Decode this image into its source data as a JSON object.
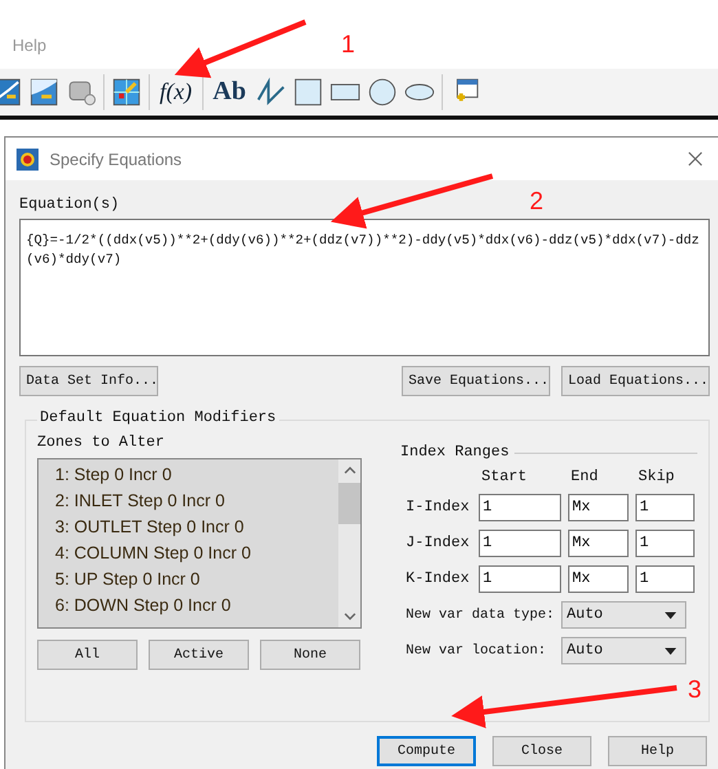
{
  "menu": {
    "items": [
      "Help"
    ]
  },
  "toolbar": [
    {
      "kind": "contour"
    },
    {
      "kind": "slice"
    },
    {
      "kind": "number"
    },
    {
      "kind": "probe"
    },
    {
      "kind": "formula",
      "label": "f(x)"
    },
    {
      "kind": "text",
      "label": "Ab"
    },
    {
      "kind": "polyline"
    },
    {
      "kind": "square"
    },
    {
      "kind": "rectangle"
    },
    {
      "kind": "circle"
    },
    {
      "kind": "ellipse"
    },
    {
      "kind": "frame"
    }
  ],
  "dialog": {
    "title": "Specify Equations",
    "equations": {
      "label": "Equation(s)",
      "value": "{Q}=-1/2*((ddx(v5))**2+(ddy(v6))**2+(ddz(v7))**2)-ddy(v5)*ddx(v6)-ddz(v5)*ddx(v7)-ddz(v6)*ddy(v7)"
    },
    "top_buttons": [
      "Data Set Info...",
      "Save Equations...",
      "Load Equations..."
    ],
    "modifiers": {
      "title": "Default Equation Modifiers",
      "zones_label": "Zones to Alter",
      "zones": [
        {
          "label": "1: Step 0 Incr 0",
          "selected": true
        },
        {
          "label": "2: INLET Step 0 Incr 0",
          "selected": true
        },
        {
          "label": "3: OUTLET Step 0 Incr 0",
          "selected": true
        },
        {
          "label": "4: COLUMN Step 0 Incr 0",
          "selected": true
        },
        {
          "label": "5: UP Step 0 Incr 0",
          "selected": true
        },
        {
          "label": "6: DOWN Step 0 Incr 0",
          "selected": true
        }
      ],
      "zone_buttons": [
        "All",
        "Active",
        "None"
      ],
      "index_ranges": {
        "title": "Index Ranges",
        "columns": [
          "Start",
          "End",
          "Skip"
        ],
        "rows": [
          {
            "label": "I-Index",
            "values": [
              "1",
              "Mx",
              "1"
            ]
          },
          {
            "label": "J-Index",
            "values": [
              "1",
              "Mx",
              "1"
            ]
          },
          {
            "label": "K-Index",
            "values": [
              "1",
              "Mx",
              "1"
            ]
          }
        ]
      },
      "dropdowns": [
        {
          "label": "New var data type:",
          "value": "Auto"
        },
        {
          "label": "New var location:",
          "value": "Auto"
        }
      ]
    },
    "bottom_buttons": [
      {
        "label": "Compute",
        "selected": true
      },
      {
        "label": "Close",
        "selected": false
      },
      {
        "label": "Help",
        "selected": false
      }
    ]
  },
  "annotations": [
    {
      "label": "1"
    },
    {
      "label": "2"
    },
    {
      "label": "3"
    }
  ]
}
